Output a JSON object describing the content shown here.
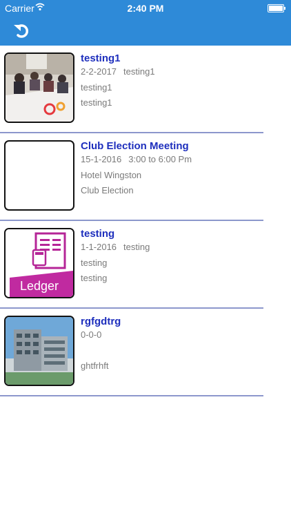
{
  "status_bar": {
    "carrier": "Carrier",
    "time": "2:40 PM"
  },
  "nav": {
    "back_icon": "undo-icon"
  },
  "colors": {
    "nav_blue": "#2e8ad8",
    "title_blue": "#1e2fbd",
    "meta_gray": "#7a7a7a",
    "divider": "#8c97cc"
  },
  "events": [
    {
      "title": "testing1",
      "date": "2-2-2017",
      "time": "testing1",
      "location": "testing1",
      "description": "testing1",
      "thumb": "meeting-photo"
    },
    {
      "title": "Club Election Meeting",
      "date": "15-1-2016",
      "time": "3:00 to 6:00 Pm",
      "location": "Hotel Wingston",
      "description": "Club Election",
      "thumb": "blank"
    },
    {
      "title": "testing",
      "date": "1-1-2016",
      "time": "testing",
      "location": "testing",
      "description": "testing",
      "thumb": "ledger-icon",
      "thumb_text": "Ledger"
    },
    {
      "title": "rgfgdtrg",
      "date": "0-0-0",
      "time": "",
      "location": "",
      "description": "ghtfrhft",
      "thumb": "building-photo"
    }
  ]
}
